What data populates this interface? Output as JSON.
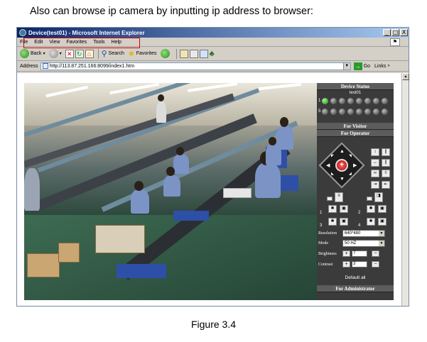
{
  "document": {
    "heading": "Also can browse ip camera by inputting ip address to browser:",
    "caption": "Figure 3.4"
  },
  "window": {
    "title": "Device(test01) - Microsoft Internet Explorer",
    "controls": {
      "minimize": "_",
      "maximize": "□",
      "close": "X"
    }
  },
  "menu": [
    "File",
    "Edit",
    "View",
    "Favorites",
    "Tools",
    "Help"
  ],
  "toolbar": {
    "back": "Back",
    "search": "Search",
    "favorites": "Favorites"
  },
  "address": {
    "label": "Address",
    "url": "http://113.87.251.166:8099/index1.htm",
    "go": "Go",
    "links": "Links"
  },
  "panel": {
    "device_status": "Device Status",
    "device_name": "test01",
    "led_rows": [
      {
        "start": "1",
        "leds": [
          true,
          false,
          false,
          false,
          false,
          false,
          false,
          false
        ]
      },
      {
        "start": "5",
        "leds": [
          false,
          false,
          false,
          false,
          false,
          false,
          false,
          false
        ]
      }
    ],
    "for_visitor": "For Visitor",
    "for_operator": "For Operator",
    "preset_labels": [
      "1",
      "2",
      "3",
      "4"
    ],
    "resolution_label": "Resolution",
    "resolution_value": "640*480",
    "mode_label": "Mode",
    "mode_value": "50 HZ",
    "brightness_label": "Brightness",
    "brightness_value": "7",
    "contrast_label": "Contrast",
    "contrast_value": "3",
    "default_all": "Default all",
    "for_administrator": "For Administrator"
  },
  "colors": {
    "panel_bg": "#3b3b3b",
    "highlight": "#e00000",
    "titlebar": "#0a246a"
  }
}
